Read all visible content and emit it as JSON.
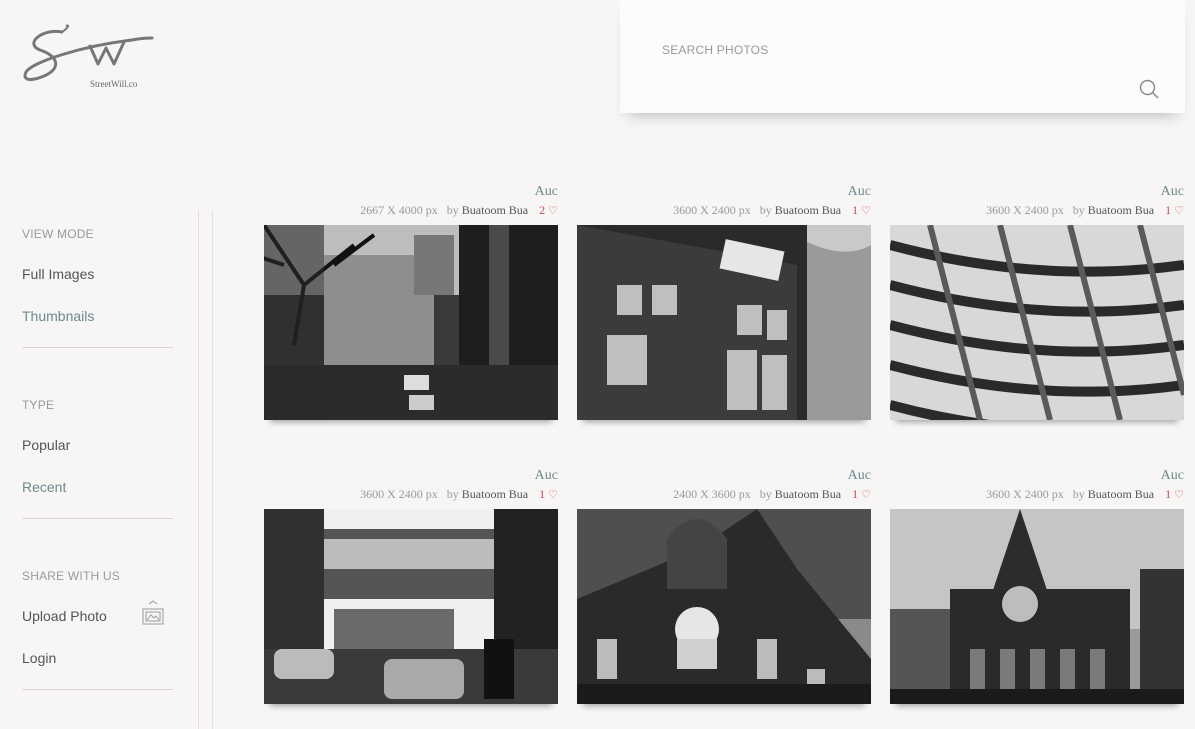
{
  "logo": {
    "text": "StreetWill.co"
  },
  "search": {
    "label": "SEARCH PHOTOS"
  },
  "sidebar": {
    "view_mode": {
      "title": "VIEW MODE",
      "items": [
        "Full Images",
        "Thumbnails"
      ]
    },
    "type": {
      "title": "TYPE",
      "items": [
        "Popular",
        "Recent"
      ]
    },
    "share": {
      "title": "SHARE WITH US",
      "upload": "Upload Photo",
      "login": "Login"
    }
  },
  "photos": [
    {
      "location": "Auc",
      "dims": "2667 X 4000 px",
      "by": "by",
      "author": "Buatoom Bua",
      "likes": "2"
    },
    {
      "location": "Auc",
      "dims": "3600 X 2400 px",
      "by": "by",
      "author": "Buatoom Bua",
      "likes": "1"
    },
    {
      "location": "Auc",
      "dims": "3600 X 2400 px",
      "by": "by",
      "author": "Buatoom Bua",
      "likes": "1"
    },
    {
      "location": "Auc",
      "dims": "3600 X 2400 px",
      "by": "by",
      "author": "Buatoom Bua",
      "likes": "1"
    },
    {
      "location": "Auc",
      "dims": "2400 X 3600 px",
      "by": "by",
      "author": "Buatoom Bua",
      "likes": "1"
    },
    {
      "location": "Auc",
      "dims": "3600 X 2400 px",
      "by": "by",
      "author": "Buatoom Bua",
      "likes": "1"
    }
  ],
  "icons": {
    "search": "search-icon",
    "upload": "image-upload-icon",
    "heart": "heart-icon"
  },
  "colors": {
    "accent": "#6b8a8c",
    "like": "#c4476a",
    "background": "#f8f6f5"
  }
}
